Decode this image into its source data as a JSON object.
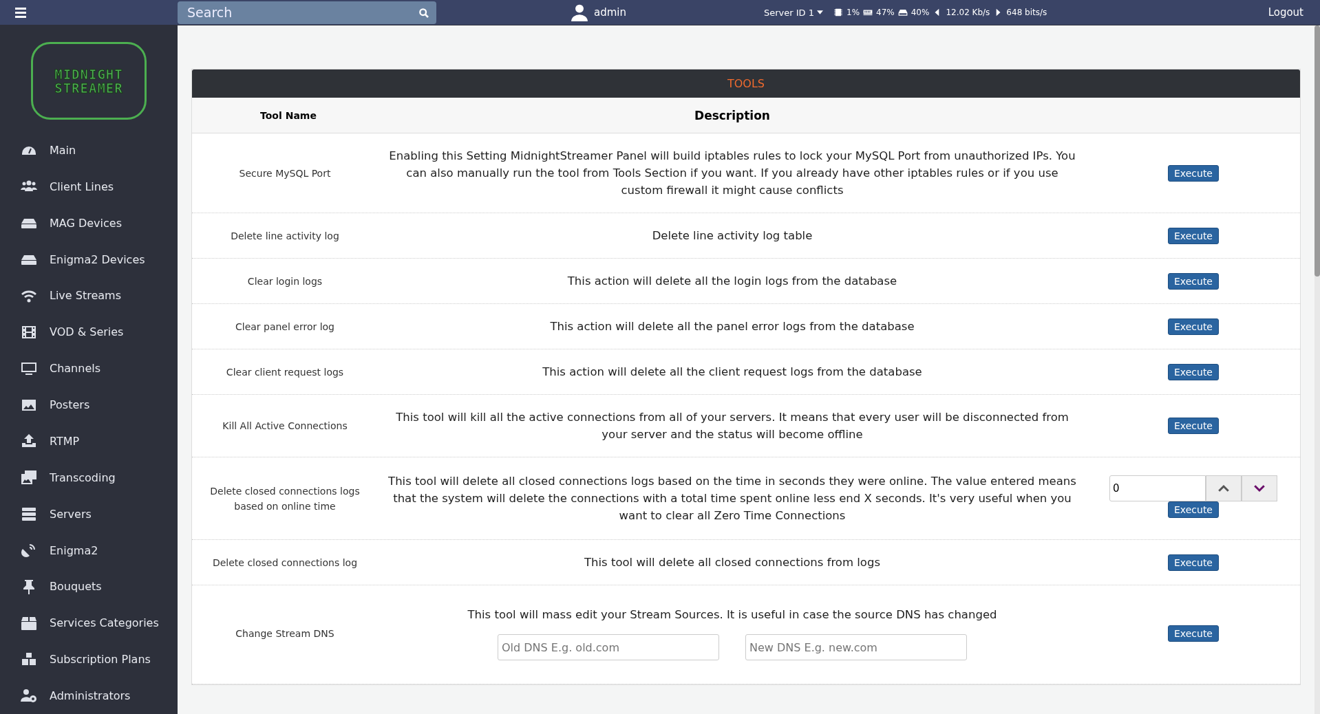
{
  "topbar": {
    "search": {
      "placeholder": "Search"
    },
    "user": "admin",
    "server": "Server ID 1",
    "stats": [
      {
        "kind": "cpu",
        "value": "1%"
      },
      {
        "kind": "ram",
        "value": "47%"
      },
      {
        "kind": "disk",
        "value": "40%"
      },
      {
        "kind": "in",
        "value": "12.02 Kb/s"
      },
      {
        "kind": "out",
        "value": "648 bits/s"
      }
    ],
    "logout": "Logout"
  },
  "sidebar": {
    "logo": [
      "MIDNIGHT",
      "STREAMER"
    ],
    "items": [
      {
        "label": "Main"
      },
      {
        "label": "Client Lines"
      },
      {
        "label": "MAG Devices"
      },
      {
        "label": "Enigma2 Devices"
      },
      {
        "label": "Live Streams"
      },
      {
        "label": "VOD & Series"
      },
      {
        "label": "Channels"
      },
      {
        "label": "Posters"
      },
      {
        "label": "RTMP"
      },
      {
        "label": "Transcoding"
      },
      {
        "label": "Servers"
      },
      {
        "label": "Enigma2"
      },
      {
        "label": "Bouquets"
      },
      {
        "label": "Services Categories"
      },
      {
        "label": "Subscription Plans"
      },
      {
        "label": "Administrators"
      }
    ]
  },
  "panel": {
    "title": "TOOLS",
    "columns": [
      "Tool Name",
      "Description"
    ],
    "rows": [
      {
        "kind": "plain",
        "name": "Secure MySQL Port",
        "description": "Enabling this Setting MidnightStreamer Panel will build iptables rules to lock your MySQL Port from unauthorized IPs. You can also manually run the tool from Tools Section if you want. If you already have other iptables rules or if you use custom firewall it might cause conflicts",
        "button": "Execute"
      },
      {
        "kind": "plain",
        "name": "Delete line activity log",
        "description": "Delete line activity log table",
        "button": "Execute"
      },
      {
        "kind": "plain",
        "name": "Clear login logs",
        "description": "This action will delete all the login logs from the database",
        "button": "Execute"
      },
      {
        "kind": "plain",
        "name": "Clear panel error log",
        "description": "This action will delete all the panel error logs from the database",
        "button": "Execute"
      },
      {
        "kind": "plain",
        "name": "Clear client request logs",
        "description": "This action will delete all the client request logs from the database",
        "button": "Execute"
      },
      {
        "kind": "plain",
        "name": "Kill All Active Connections",
        "description": "This tool will kill all the active connections from all of your servers. It means that every user will be disconnected from your server and the status will become offline",
        "button": "Execute"
      },
      {
        "kind": "number",
        "name": "Delete closed connections logs based on online time",
        "description": "This tool will delete all closed connections logs based on the time in seconds they were online. The value entered means that the system will delete the connections with a total time spent online less end X seconds. It's very useful when you want to clear all Zero Time Connections",
        "value": "0",
        "button": "Execute"
      },
      {
        "kind": "plain",
        "name": "Delete closed connections log",
        "description": "This tool will delete all closed connections from logs",
        "button": "Execute"
      },
      {
        "kind": "dns",
        "name": "Change Stream DNS",
        "description": "This tool will mass edit your Stream Sources. It is useful in case the source DNS has changed",
        "fields": [
          {
            "placeholder": "Old DNS E.g. old.com"
          },
          {
            "placeholder": "New DNS E.g. new.com"
          }
        ],
        "button": "Execute"
      }
    ]
  }
}
